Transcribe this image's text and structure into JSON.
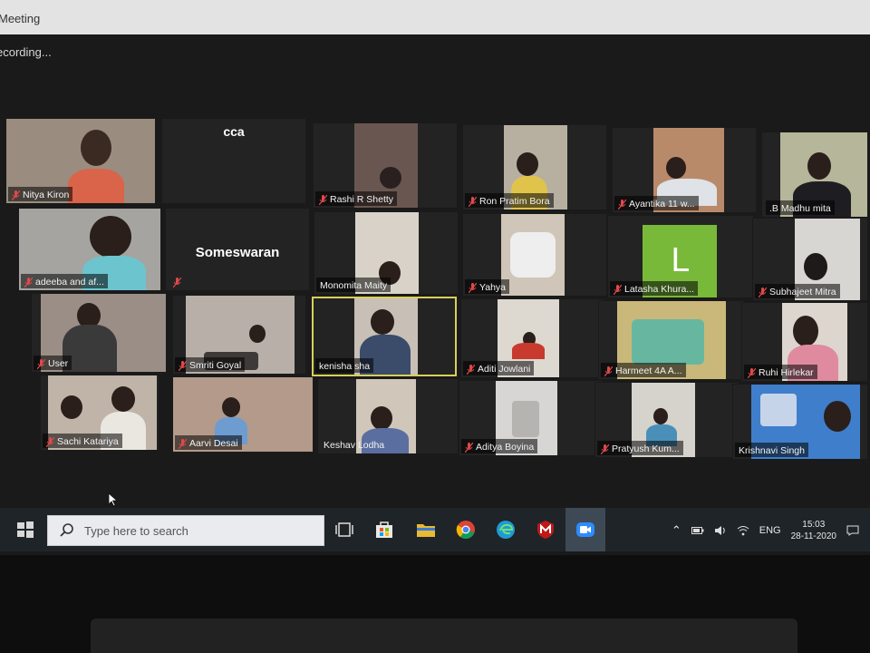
{
  "window": {
    "title": "Meeting",
    "recording": "ecording..."
  },
  "participants": [
    {
      "name": "Nitya Kiron"
    },
    {
      "name": "cca"
    },
    {
      "name": "Rashi R Shetty"
    },
    {
      "name": "Ron Pratim Bora"
    },
    {
      "name": "Ayantika 11 w..."
    },
    {
      "name": ".B Madhu mita"
    },
    {
      "name": "adeeba and af..."
    },
    {
      "name": "Someswaran"
    },
    {
      "name": "Monomita Maity"
    },
    {
      "name": "Yahya"
    },
    {
      "name": "Latasha Khura..."
    },
    {
      "name": "Subhajeet Mitra"
    },
    {
      "name": "User"
    },
    {
      "name": "Smriti Goyal"
    },
    {
      "name": "kenisha sha"
    },
    {
      "name": "Aditi Jowlani"
    },
    {
      "name": "Harmeet 4A A..."
    },
    {
      "name": "Ruhi Hirlekar"
    },
    {
      "name": "Sachi Katariya"
    },
    {
      "name": "Aarvi Desai"
    },
    {
      "name": "Keshav Lodha"
    },
    {
      "name": "Aditya Boyina"
    },
    {
      "name": "Pratyush Kum..."
    },
    {
      "name": "Krishnavi Singh"
    }
  ],
  "latasha_initial": "L",
  "taskbar": {
    "search_placeholder": "Type here to search",
    "language": "ENG",
    "time": "15:03",
    "date": "28-11-2020",
    "icons": [
      "task-view-icon",
      "store-icon",
      "file-explorer-icon",
      "chrome-icon",
      "edge-icon",
      "mcafee-icon",
      "zoom-icon"
    ]
  },
  "colors": {
    "active_speaker": "#d9cf5a",
    "cca_bar": "#e6d94a",
    "latasha_bg": "#79b93a",
    "mic_muted": "#e04848"
  }
}
